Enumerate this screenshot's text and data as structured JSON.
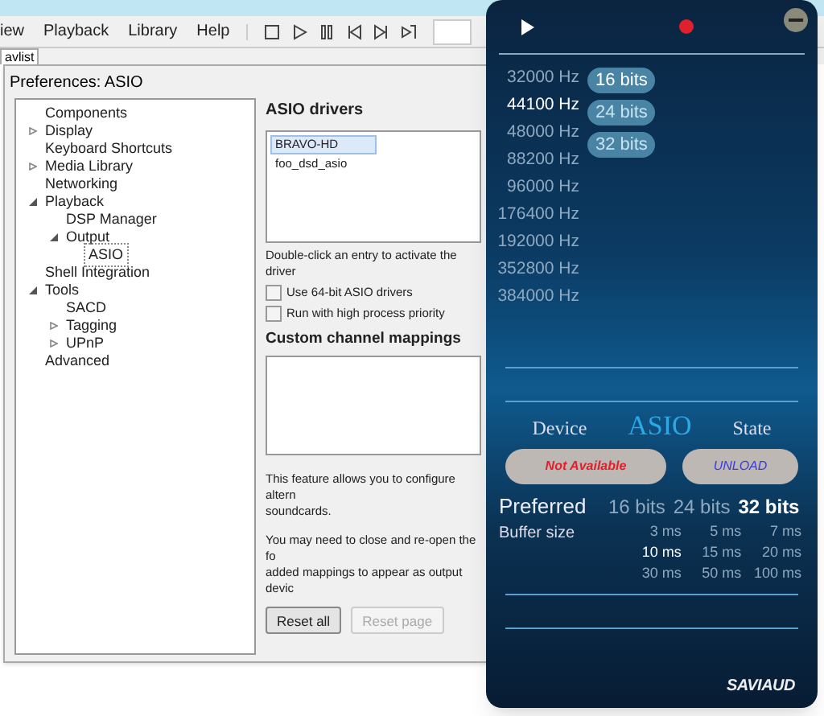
{
  "menu": [
    "iew",
    "Playback",
    "Library",
    "Help"
  ],
  "tab": {
    "label": "avlist"
  },
  "dialog": {
    "title": "Preferences: ASIO",
    "tree": [
      {
        "label": "Components",
        "expanded": false,
        "selected": false
      },
      {
        "label": "Display",
        "expanded": false,
        "selected": false
      },
      {
        "label": "Keyboard Shortcuts",
        "expanded": false,
        "selected": false
      },
      {
        "label": "Media Library",
        "expanded": false,
        "selected": false
      },
      {
        "label": "Networking",
        "expanded": false,
        "selected": false
      },
      {
        "label": "Playback",
        "expanded": true,
        "selected": false,
        "children": [
          {
            "label": "DSP Manager",
            "expanded": false,
            "selected": false
          },
          {
            "label": "Output",
            "expanded": true,
            "selected": false,
            "children": [
              {
                "label": "ASIO",
                "expanded": false,
                "selected": true
              }
            ]
          }
        ]
      },
      {
        "label": "Shell Integration",
        "expanded": false,
        "selected": false
      },
      {
        "label": "Tools",
        "expanded": true,
        "selected": false,
        "children": [
          {
            "label": "SACD",
            "expanded": false,
            "selected": false
          },
          {
            "label": "Tagging",
            "expanded": false,
            "selected": false
          },
          {
            "label": "UPnP",
            "expanded": false,
            "selected": false
          }
        ]
      },
      {
        "label": "Advanced",
        "expanded": false,
        "selected": false
      }
    ],
    "drivers_heading": "ASIO drivers",
    "drivers": [
      {
        "label": "BRAVO-HD",
        "selected": true
      },
      {
        "label": "foo_dsd_asio",
        "selected": false
      }
    ],
    "drivers_hint": "Double-click an entry to activate the driver",
    "options": [
      {
        "label": "Use 64-bit ASIO drivers",
        "checked": false
      },
      {
        "label": "Run with high process priority",
        "checked": false
      }
    ],
    "mappings_heading": "Custom channel mappings",
    "notes": [
      [
        "This feature allows you to configure altern",
        "soundcards."
      ],
      [
        "You may need to close and re-open the fo",
        "added mappings to appear as output devic"
      ]
    ],
    "buttons": [
      {
        "label": "Reset all",
        "disabled": false
      },
      {
        "label": "Reset page",
        "disabled": true
      }
    ]
  },
  "panel": {
    "sample_rates": [
      {
        "label": "32000 Hz",
        "selected": false
      },
      {
        "label": "44100 Hz",
        "selected": true
      },
      {
        "label": "48000 Hz",
        "selected": false
      },
      {
        "label": "88200 Hz",
        "selected": false
      },
      {
        "label": "96000 Hz",
        "selected": false
      },
      {
        "label": "176400 Hz",
        "selected": false
      },
      {
        "label": "192000 Hz",
        "selected": false
      },
      {
        "label": "352800 Hz",
        "selected": false
      },
      {
        "label": "384000 Hz",
        "selected": false
      }
    ],
    "bit_depths": [
      {
        "label": "16 bits",
        "selected": true
      },
      {
        "label": "24 bits",
        "selected": false
      },
      {
        "label": "32 bits",
        "selected": false
      }
    ],
    "device_label": "Device",
    "mode": "ASIO",
    "state_label": "State",
    "device_button": "Not Available",
    "state_button": "UNLOAD",
    "preferred_label": "Preferred",
    "buffer_label": "Buffer size",
    "preferred_bits": [
      {
        "label": "16 bits",
        "selected": false
      },
      {
        "label": "24 bits",
        "selected": false
      },
      {
        "label": "32 bits",
        "selected": true
      }
    ],
    "buffer_sizes": [
      {
        "label": "3 ms",
        "selected": false
      },
      {
        "label": "5 ms",
        "selected": false
      },
      {
        "label": "7 ms",
        "selected": false
      },
      {
        "label": "10 ms",
        "selected": true
      },
      {
        "label": "15 ms",
        "selected": false
      },
      {
        "label": "20 ms",
        "selected": false
      },
      {
        "label": "30 ms",
        "selected": false
      },
      {
        "label": "50 ms",
        "selected": false
      },
      {
        "label": "100 ms",
        "selected": false
      }
    ],
    "logo": "SAVIAUD"
  }
}
